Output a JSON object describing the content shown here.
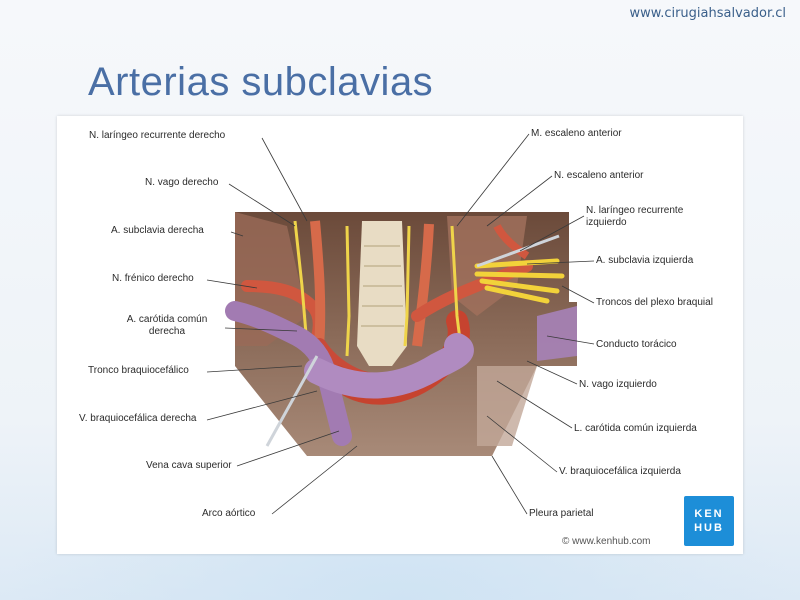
{
  "header": {
    "site_url": "www.cirugiahsalvador.cl",
    "title": "Arterias subclavias"
  },
  "figure": {
    "labels_left": {
      "n_laringeo_recurrente_derecho": "N. laríngeo recurrente derecho",
      "n_vago_derecho": "N. vago derecho",
      "a_subclavia_derecha": "A. subclavia derecha",
      "n_frenico_derecho": "N. frénico derecho",
      "a_carotida_comun_derecha_1": "A. carótida común",
      "a_carotida_comun_derecha_2": "derecha",
      "tronco_braquiocefalico": "Tronco braquiocefálico",
      "v_braquiocefalica_derecha": "V. braquiocefálica derecha",
      "vena_cava_superior": "Vena cava superior",
      "arco_aortico": "Arco aórtico"
    },
    "labels_right": {
      "m_escaleno_anterior": "M. escaleno anterior",
      "n_escaleno_anterior": "N. escaleno anterior",
      "n_laringeo_recurrente_izquierdo_1": "N. laríngeo recurrente",
      "n_laringeo_recurrente_izquierdo_2": "izquierdo",
      "a_subclavia_izquierda": "A. subclavia izquierda",
      "troncos_plexo_braquial": "Troncos del plexo braquial",
      "conducto_toracico": "Conducto torácico",
      "n_vago_izquierdo": "N. vago izquierdo",
      "l_carotida_comun_izquierda": "L. carótida común izquierda",
      "v_braquiocefalica_izquierda": "V. braquiocefálica izquierda",
      "pleura_parietal": "Pleura parietal"
    },
    "brand": {
      "line1": "KEN",
      "line2": "HUB",
      "copyright": "© www.kenhub.com"
    }
  }
}
